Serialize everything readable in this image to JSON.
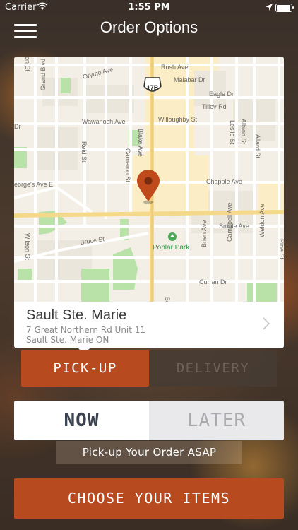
{
  "status_bar": {
    "carrier": "Carrier",
    "time": "1:55 PM"
  },
  "nav": {
    "title": "Order Options",
    "menu_icon": "hamburger-menu-icon"
  },
  "map": {
    "streets": {
      "rush": "Rush Ave",
      "malabar": "Malabar Dr",
      "oryme": "Oryme Ave",
      "eagle": "Eagle Dr",
      "tilley": "Tilley Rd",
      "wawanosh": "Wawanosh Ave",
      "willoughby": "Willoughby St",
      "chapple": "Chapple Ave",
      "georges": "eorge's Ave E",
      "bruce": "Bruce St",
      "smale": "Smale Ave",
      "curran": "Curran Dr",
      "grand": "Grand Blvd",
      "reid": "Reid St",
      "cameron": "Cameron St",
      "blake": "Blake Ave",
      "leslie": "Leslie St",
      "albion": "Albion St",
      "allard": "Allard St",
      "wilson": "Wilson St",
      "brien": "Brien Ave",
      "campbell": "Campbell Ave",
      "weldon": "Weldon Ave",
      "pine": "Pine St",
      "be": "Be",
      "on": "on St",
      "dr": "Dr"
    },
    "highway_shield": "17B",
    "park": "Poplar Park",
    "pin_icon": "map-pin-icon"
  },
  "location": {
    "name": "Sault Ste. Marie",
    "address_line1": "7 Great Northern Rd Unit 11",
    "address_line2": "Sault Ste. Marie ON"
  },
  "order_type": {
    "pickup": "PICK-UP",
    "delivery": "DELIVERY",
    "selected": "pickup"
  },
  "timing": {
    "now": "NOW",
    "later": "LATER",
    "selected": "now",
    "hint": "Pick-up Your Order ASAP"
  },
  "cta": {
    "label": "CHOOSE YOUR ITEMS"
  },
  "colors": {
    "accent": "#b84a1f",
    "map_bg": "#f3efe6",
    "road_major": "#f5d98a",
    "park": "#b9e2a8"
  }
}
